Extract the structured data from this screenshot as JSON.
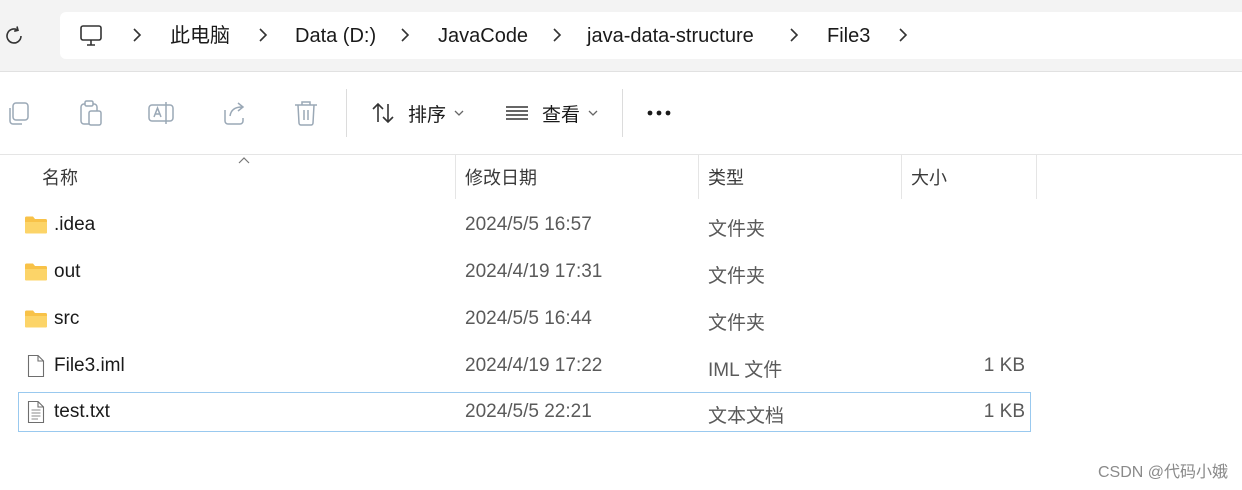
{
  "address": {
    "crumbs": [
      "此电脑",
      "Data (D:)",
      "JavaCode",
      "java-data-structure",
      "File3"
    ]
  },
  "toolbar": {
    "sort_label": "排序",
    "view_label": "查看"
  },
  "columns": {
    "name": "名称",
    "date": "修改日期",
    "type": "类型",
    "size": "大小"
  },
  "files": [
    {
      "name": ".idea",
      "date": "2024/5/5 16:57",
      "type": "文件夹",
      "size": "",
      "icon": "folder-icon"
    },
    {
      "name": "out",
      "date": "2024/4/19 17:31",
      "type": "文件夹",
      "size": "",
      "icon": "folder-icon"
    },
    {
      "name": "src",
      "date": "2024/5/5 16:44",
      "type": "文件夹",
      "size": "",
      "icon": "folder-icon"
    },
    {
      "name": "File3.iml",
      "date": "2024/4/19 17:22",
      "type": "IML 文件",
      "size": "1 KB",
      "icon": "file-icon"
    },
    {
      "name": "test.txt",
      "date": "2024/5/5 22:21",
      "type": "文本文档",
      "size": "1 KB",
      "icon": "text-file-icon",
      "selected": true
    }
  ],
  "watermark": "CSDN @代码小娥"
}
